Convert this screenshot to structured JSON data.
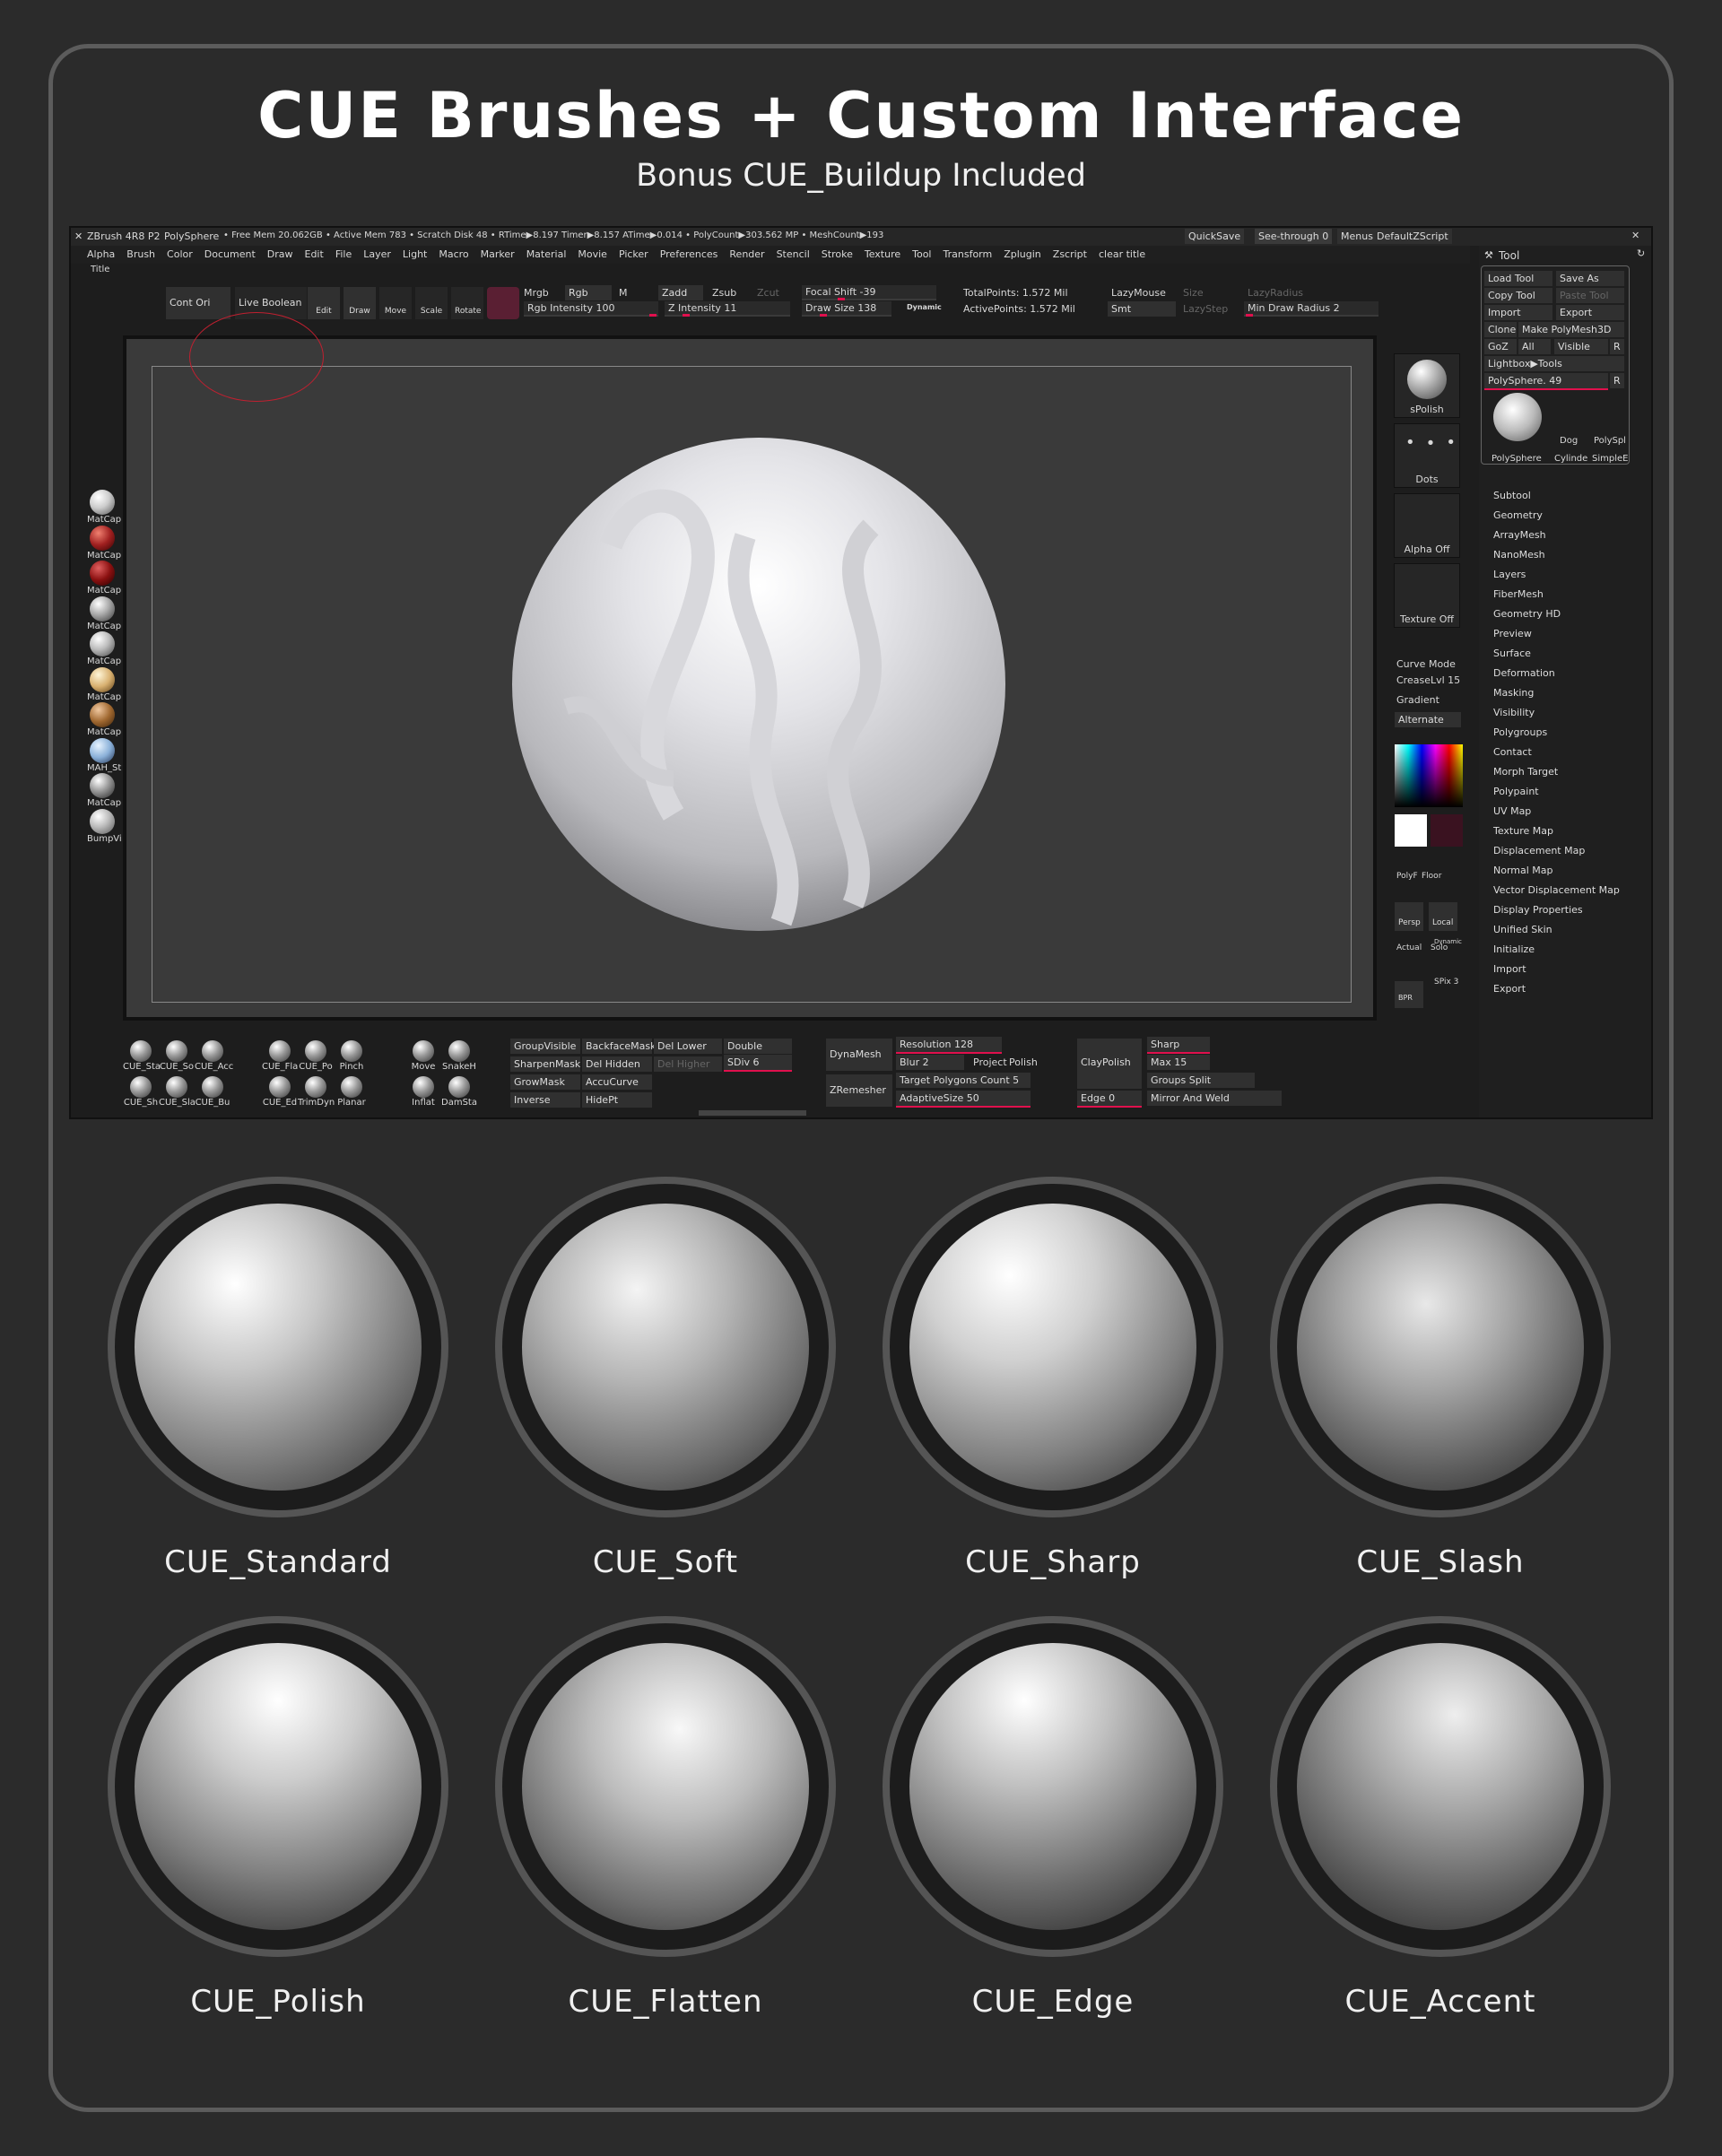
{
  "header": {
    "title": "CUE Brushes + Custom Interface",
    "subtitle": "Bonus CUE_Buildup Included"
  },
  "status": {
    "app": "ZBrush 4R8 P2",
    "tool": "PolySphere",
    "mem": "• Free Mem 20.062GB • Active Mem 783 • Scratch Disk 48 •  RTime▶8.197 Timer▶8.157 ATime▶0.014 • PolyCount▶303.562 MP  • MeshCount▶193",
    "quicksave": "QuickSave",
    "seethrough": "See-through  0",
    "menus": "Menus",
    "script": "DefaultZScript"
  },
  "menu": [
    "Alpha",
    "Brush",
    "Color",
    "Document",
    "Draw",
    "Edit",
    "File",
    "Layer",
    "Light",
    "Macro",
    "Marker",
    "Material",
    "Movie",
    "Picker",
    "Preferences",
    "Render",
    "Stencil",
    "Stroke",
    "Texture",
    "Tool",
    "Transform",
    "Zplugin",
    "Zscript",
    "clear title"
  ],
  "menu_title": "Title",
  "top": {
    "contori": "Cont Ori",
    "liveboolean": "Live Boolean",
    "edit": "Edit",
    "draw": "Draw",
    "move": "Move",
    "scale": "Scale",
    "rotate": "Rotate",
    "mrgb": "Mrgb",
    "rgb": "Rgb",
    "m": "M",
    "zadd": "Zadd",
    "zsub": "Zsub",
    "zcut": "Zcut",
    "rgbint": "Rgb Intensity 100",
    "zint": "Z Intensity 11",
    "focal": "Focal Shift -39",
    "drawsize": "Draw Size 138",
    "dynamic": "Dynamic",
    "totalpts": "TotalPoints: 1.572 Mil",
    "activepts": "ActivePoints: 1.572 Mil",
    "lazymouse": "LazyMouse",
    "smt": "Smt",
    "size": "Size",
    "lazystep": "LazyStep",
    "lazyradius": "LazyRadius",
    "mindraw": "Min Draw Radius 2"
  },
  "matcaps": [
    "MatCap",
    "MatCap",
    "MatCap",
    "MatCap",
    "MatCap",
    "MatCap",
    "MatCap",
    "MAH_St",
    "MatCap",
    "BumpVi"
  ],
  "righttools": {
    "spolish": "sPolish",
    "dots": "Dots",
    "alpha": "Alpha Off",
    "texture": "Texture Off",
    "curve": "Curve Mode",
    "crease": "CreaseLvl 15",
    "gradient": "Gradient",
    "alternate": "Alternate",
    "polyf": "PolyF",
    "floor": "Floor",
    "persp": "Persp",
    "local": "Local",
    "actual": "Actual",
    "solo": "Solo",
    "spix": "SPix 3",
    "dynamic": "Dynamic",
    "bpr": "BPR"
  },
  "toolpanel": {
    "title": "Tool",
    "load": "Load Tool",
    "saveas": "Save As",
    "copy": "Copy Tool",
    "paste": "Paste Tool",
    "import": "Import",
    "export": "Export",
    "clone": "Clone",
    "make": "Make PolyMesh3D",
    "goz": "GoZ",
    "all": "All",
    "visible": "Visible",
    "r": "R",
    "lightbox": "Lightbox▶Tools",
    "polysphere": "PolySphere. 49",
    "r2": "R",
    "thumbs": [
      "PolySphere",
      "Dog",
      "PolySpl",
      "Cylinde",
      "SimpleE"
    ],
    "items": [
      "Subtool",
      "Geometry",
      "ArrayMesh",
      "NanoMesh",
      "Layers",
      "FiberMesh",
      "Geometry HD",
      "Preview",
      "Surface",
      "Deformation",
      "Masking",
      "Visibility",
      "Polygroups",
      "Contact",
      "Morph Target",
      "Polypaint",
      "UV Map",
      "Texture Map",
      "Displacement Map",
      "Normal Map",
      "Vector Displacement Map",
      "Display Properties",
      "Unified Skin",
      "Initialize",
      "Import",
      "Export"
    ]
  },
  "bottom": {
    "brushes1": [
      "CUE_Sta",
      "CUE_So",
      "CUE_Acc",
      "CUE_Fla",
      "CUE_Po",
      "Pinch",
      "Move",
      "SnakeH"
    ],
    "brushes2": [
      "CUE_Sh",
      "CUE_Sla",
      "CUE_Bu",
      "CUE_Ed",
      "TrimDyn",
      "Planar",
      "Inflat",
      "DamSta"
    ],
    "groupvisible": "GroupVisible",
    "backface": "BackfaceMask",
    "dellower": "Del Lower",
    "double": "Double",
    "sharpen": "SharpenMask",
    "delhidden": "Del Hidden",
    "delhigher": "Del Higher",
    "sdiv": "SDiv 6",
    "grow": "GrowMask",
    "accucurve": "AccuCurve",
    "inverse": "Inverse",
    "hidept": "HidePt",
    "dynamesh": "DynaMesh",
    "zremesher": "ZRemesher",
    "resolution": "Resolution 128",
    "blur": "Blur 2",
    "project": "Project",
    "polish": "Polish",
    "target": "Target Polygons Count 5",
    "adaptive": "AdaptiveSize 50",
    "claypolish": "ClayPolish",
    "sharp": "Sharp",
    "max": "Max 15",
    "groupssplit": "Groups Split",
    "edge": "Edge 0",
    "mirror": "Mirror And Weld"
  },
  "brushes": [
    "CUE_Standard",
    "CUE_Soft",
    "CUE_Sharp",
    "CUE_Slash",
    "CUE_Polish",
    "CUE_Flatten",
    "CUE_Edge",
    "CUE_Accent"
  ]
}
